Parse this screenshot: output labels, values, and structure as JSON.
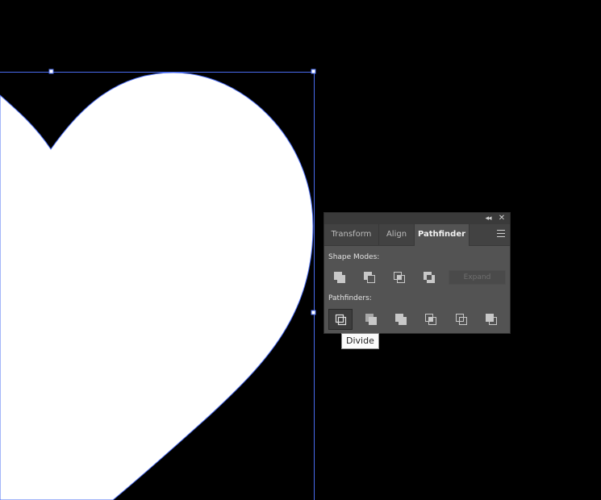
{
  "panel": {
    "tabs": [
      "Transform",
      "Align",
      "Pathfinder"
    ],
    "active_tab": "Pathfinder",
    "shape_modes_label": "Shape Modes:",
    "pathfinders_label": "Pathfinders:",
    "expand_label": "Expand",
    "shape_mode_icons": [
      "unite-icon",
      "minus-front-icon",
      "intersect-icon",
      "exclude-icon"
    ],
    "pathfinder_icons": [
      "divide-icon",
      "trim-icon",
      "merge-icon",
      "crop-icon",
      "outline-icon",
      "minus-back-icon"
    ]
  },
  "tooltip": {
    "text": "Divide"
  },
  "colors": {
    "canvas_bg": "#000000",
    "shape_fill": "#ffffff",
    "selection_color": "#4a6cf0",
    "panel_bg": "#535353"
  }
}
